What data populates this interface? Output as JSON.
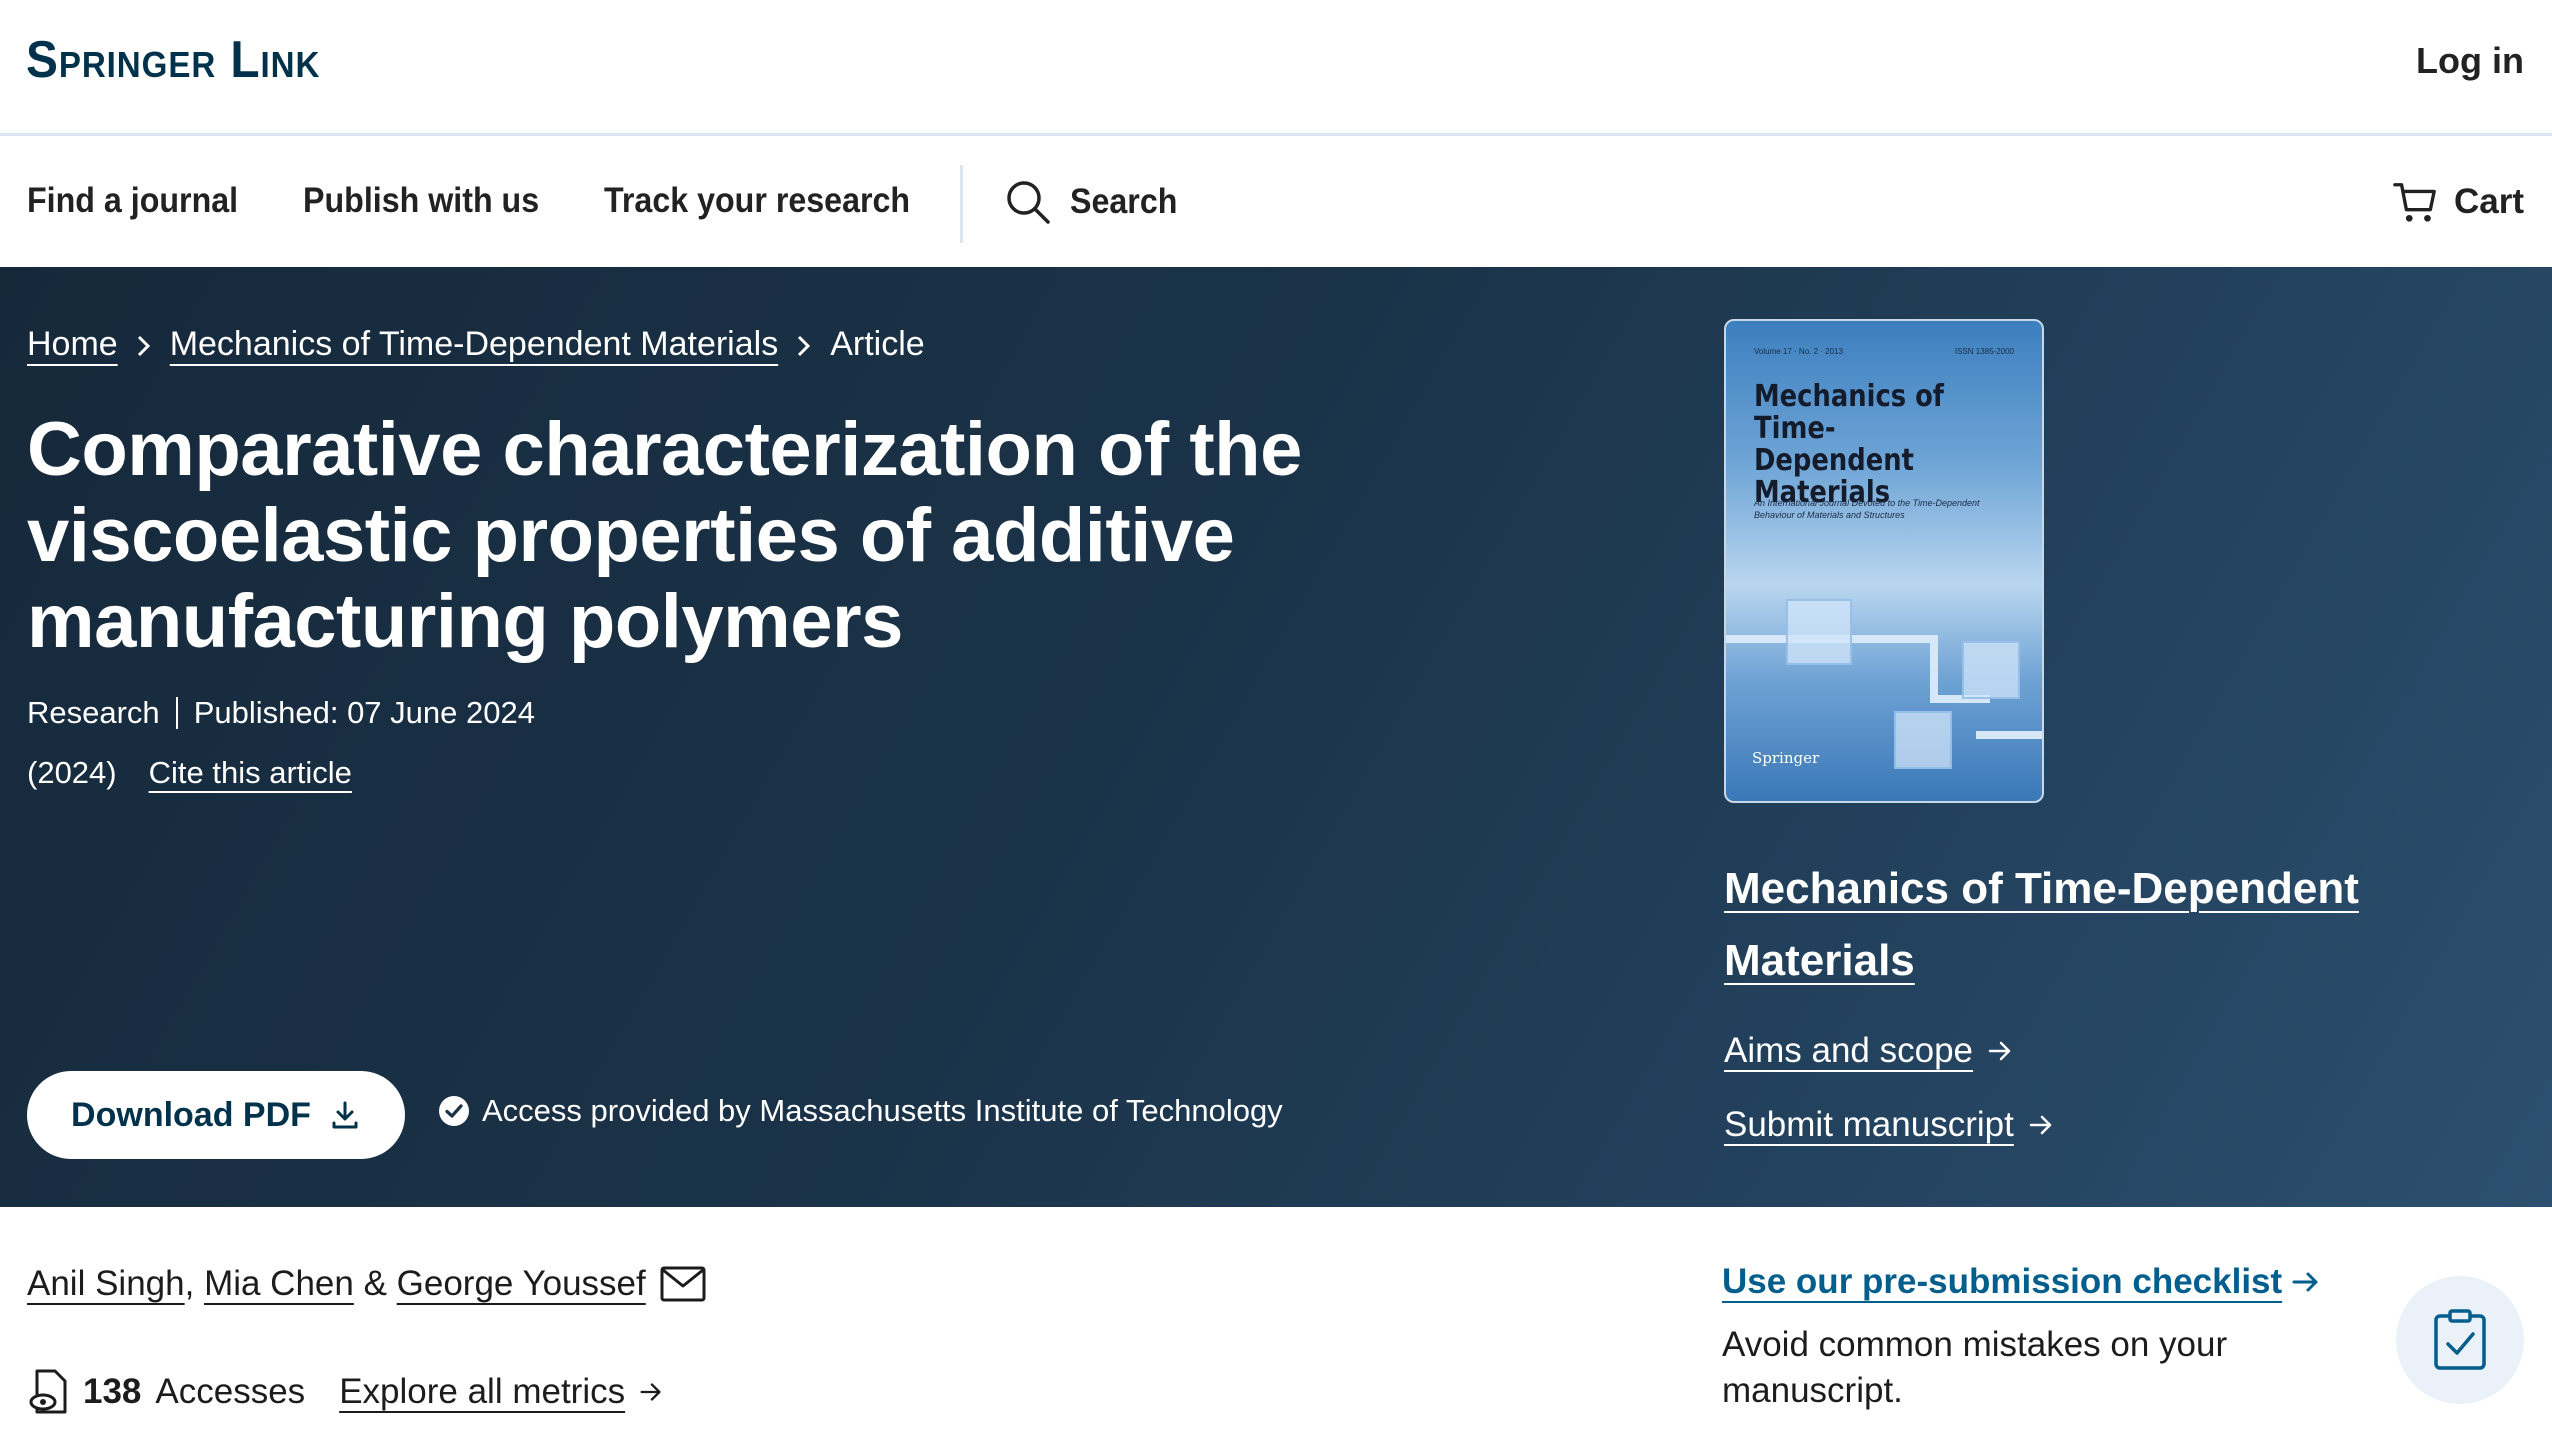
{
  "header": {
    "logo": "Springer Link",
    "login": "Log in"
  },
  "nav": {
    "items": [
      "Find a journal",
      "Publish with us",
      "Track your research"
    ],
    "search": "Search",
    "cart": "Cart"
  },
  "breadcrumb": {
    "home": "Home",
    "journal": "Mechanics of Time-Dependent Materials",
    "current": "Article"
  },
  "article": {
    "title": "Comparative characterization of the viscoelastic properties of additive manufacturing polymers",
    "type": "Research",
    "published": "Published: 07 June 2024",
    "year": "(2024)",
    "cite": "Cite this article",
    "download": "Download PDF",
    "access": "Access provided by Massachusetts Institute of Technology"
  },
  "journal": {
    "cover_title": "Mechanics of Time-Dependent Materials",
    "cover_volume": "Volume 17 · No. 2 · 2013",
    "cover_issn": "ISSN 1385-2000",
    "cover_subtitle": "An International Journal Devoted to the Time-Dependent Behaviour of Materials and Structures",
    "cover_publisher": "Springer",
    "name": "Mechanics of Time-Dependent Materials",
    "aims": "Aims and scope",
    "submit": "Submit manuscript"
  },
  "authors": {
    "list": [
      "Anil Singh",
      "Mia Chen",
      "George Youssef"
    ],
    "sep1": ", ",
    "sep2": " & "
  },
  "metrics": {
    "accesses_count": "138",
    "accesses_label": "Accesses",
    "explore": "Explore all metrics"
  },
  "checklist": {
    "link": "Use our pre-submission checklist",
    "desc": "Avoid common mistakes on your manuscript."
  },
  "colors": {
    "brand_dark": "#01324b",
    "link_blue": "#025e8d",
    "hero_bg": "#1b3349"
  }
}
